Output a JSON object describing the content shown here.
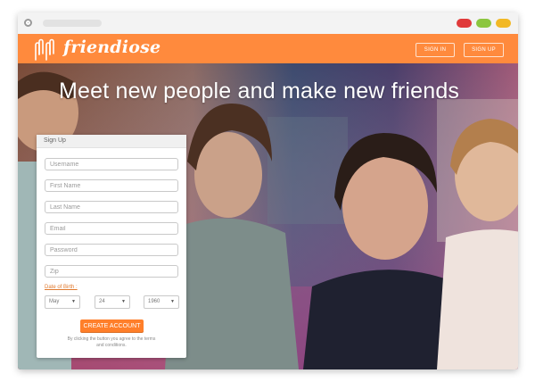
{
  "app": {
    "brand": "friendiose"
  },
  "nav": {
    "sign_in": "SIGN IN",
    "sign_up": "SIGN UP"
  },
  "hero": {
    "headline": "Meet new people and make new friends"
  },
  "signup_form": {
    "title": "Sign Up",
    "placeholders": {
      "username": "Username",
      "first_name": "First Name",
      "last_name": "Last Name",
      "email": "Email",
      "password": "Password",
      "zip": "Zip"
    },
    "dob_label": "Date of Birth :",
    "dob": {
      "month": "May",
      "day": "24",
      "year": "1960"
    },
    "submit": "CREATE ACCOUNT",
    "terms": "By clicking the button you agree to the terms and conditions."
  },
  "colors": {
    "accent": "#ff8a3d",
    "button": "#ff7f2a",
    "window_red": "#e03a3a",
    "window_green": "#8cc63f",
    "window_yellow": "#f2b824"
  }
}
